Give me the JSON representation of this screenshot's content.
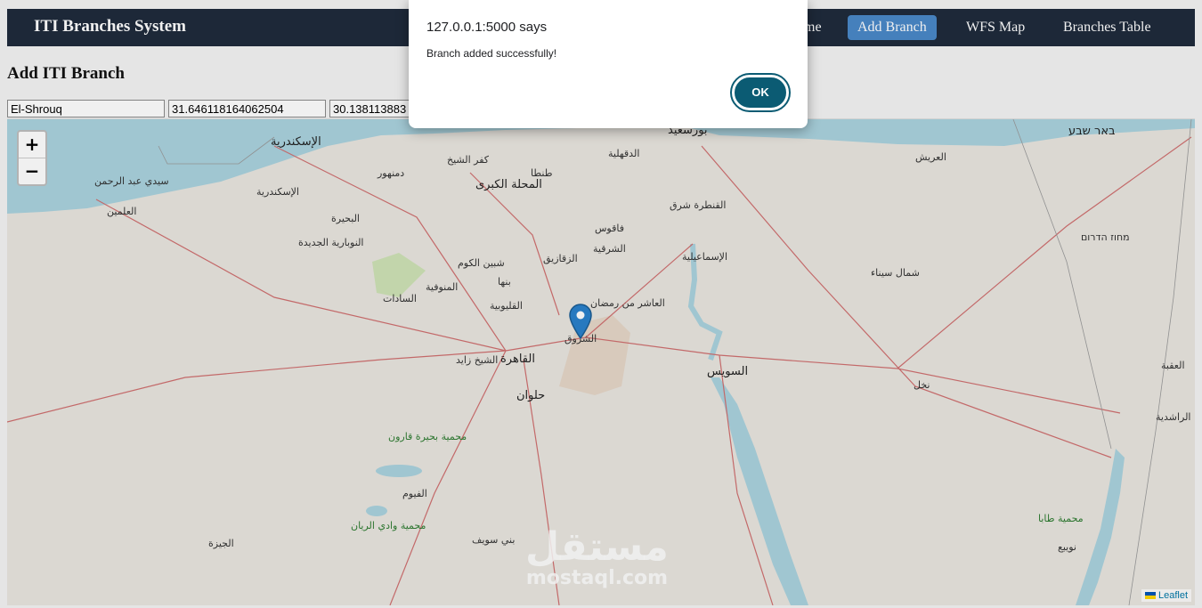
{
  "navbar": {
    "brand": "ITI Branches System",
    "links": [
      {
        "label": "me",
        "active": false
      },
      {
        "label": "Add Branch",
        "active": true
      },
      {
        "label": "WFS Map",
        "active": false
      },
      {
        "label": "Branches Table",
        "active": false
      }
    ]
  },
  "form": {
    "heading": "Add ITI Branch",
    "name_value": "El-Shrouq",
    "lat_value": "31.646118164062504",
    "lng_value": "30.138113883"
  },
  "map": {
    "zoom_in": "+",
    "zoom_out": "−",
    "attribution": "Leaflet",
    "marker_icon": "map-pin-icon",
    "labels": [
      "الإسكندرية",
      "بورسعيد",
      "באר שבע",
      "المحلة الكبرى",
      "كفر الشيخ",
      "طنطا",
      "دمنهور",
      "سيدي عبد الرحمن",
      "العلمين",
      "الإسكندرية",
      "البحيرة",
      "النوبارية الجديدة",
      "الدقهلية",
      "القنطرة شرق",
      "فاقوس",
      "الزقازيق",
      "الشرقية",
      "الإسماعيلية",
      "شبين الكوم",
      "بنها",
      "المنوفية",
      "السادات",
      "القليوبية",
      "العاشر من رمضان",
      "الشروق",
      "القاهرة",
      "الشيخ زايد",
      "حلوان",
      "السويس",
      "نخل",
      "شمال سيناء",
      "العريش",
      "מחוז הדרום",
      "العقبة",
      "الراشدية",
      "محمية بحيرة قارون",
      "الفيوم",
      "محمية وادي الريان",
      "بني سويف",
      "الجيزة",
      "نويبع",
      "محمية طابا"
    ]
  },
  "watermark": {
    "arabic": "مستقل",
    "latin": "mostaql.com"
  },
  "dialog": {
    "title": "127.0.0.1:5000 says",
    "message": "Branch added successfully!",
    "ok_label": "OK"
  },
  "colors": {
    "navbar": "#1f2b3c",
    "active_link": "#4a89c8",
    "ok_button": "#0b5b73",
    "sea": "#aad3df"
  }
}
